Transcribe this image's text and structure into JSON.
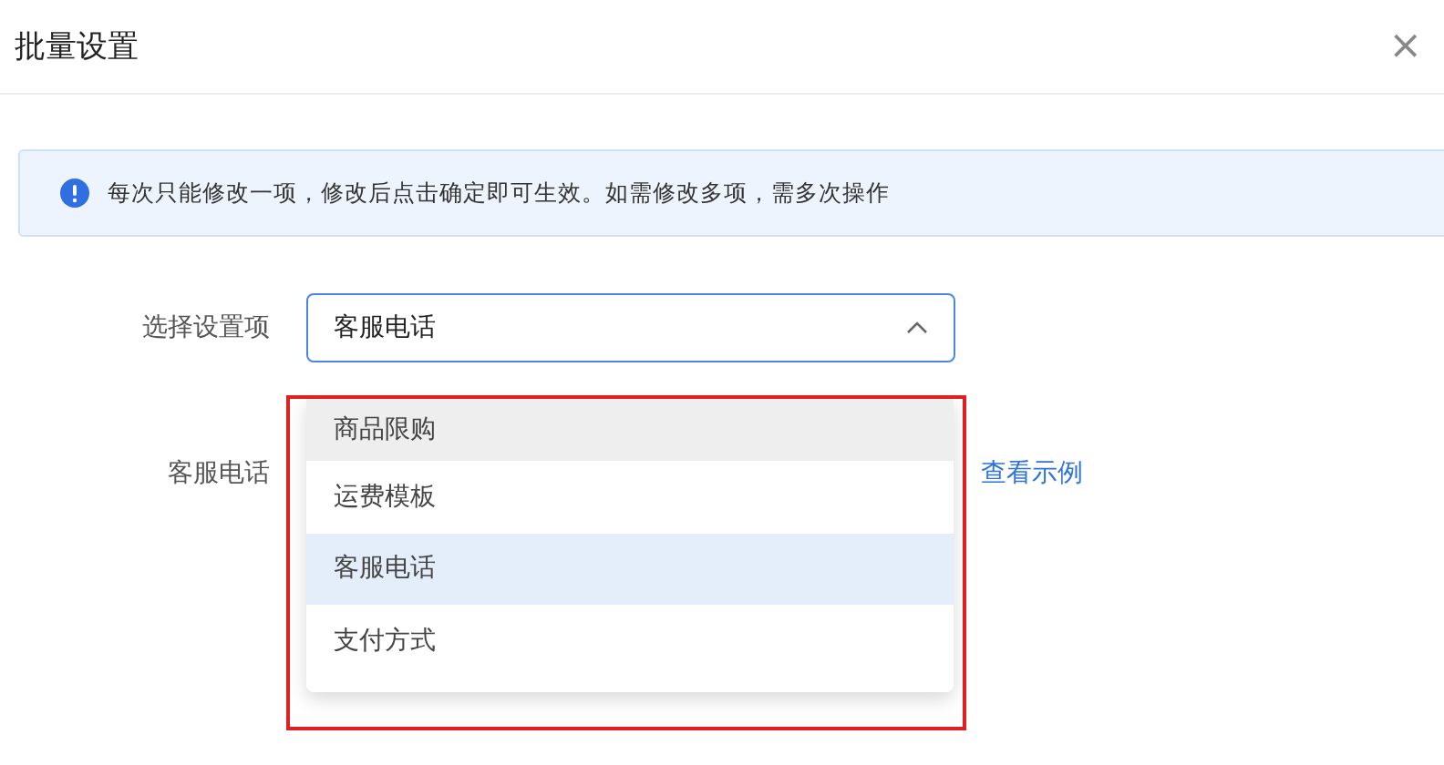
{
  "dialog": {
    "title": "批量设置",
    "close": "×"
  },
  "alert": {
    "message": "每次只能修改一项，修改后点击确定即可生效。如需修改多项，需多次操作"
  },
  "form": {
    "select_label": "选择设置项",
    "select_value": "客服电话",
    "expanded": true,
    "phone_label": "客服电话",
    "example_link": "查看示例"
  },
  "dropdown": {
    "options": [
      {
        "label": "商品限购",
        "hovered": true,
        "selected": false
      },
      {
        "label": "运费模板",
        "hovered": false,
        "selected": false
      },
      {
        "label": "客服电话",
        "hovered": false,
        "selected": true
      },
      {
        "label": "支付方式",
        "hovered": false,
        "selected": false
      }
    ],
    "highlighted": true
  }
}
